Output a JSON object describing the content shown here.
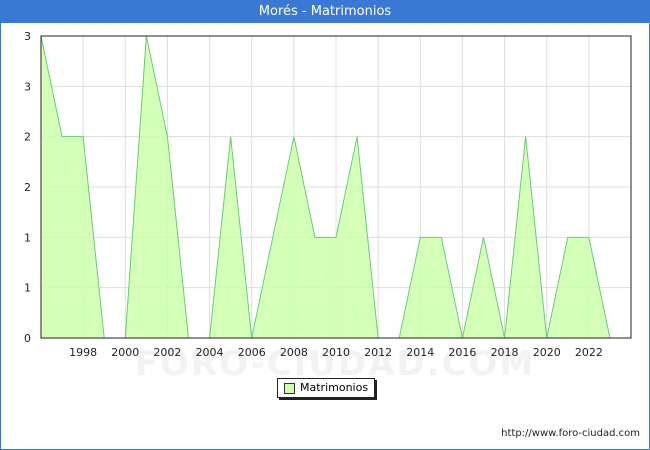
{
  "title": "Morés - Matrimonios",
  "source_url": "http://www.foro-ciudad.com",
  "watermark": "FORO-CIUDAD.COM",
  "colors": {
    "title_bg": "#3a78d6",
    "area_fill": "#ccffaa",
    "area_line": "#66cc77",
    "grid": "#dddddd"
  },
  "chart_data": {
    "type": "area",
    "title": "Morés - Matrimonios",
    "xlabel": "",
    "ylabel": "",
    "x": [
      1996,
      1997,
      1998,
      1999,
      2000,
      2001,
      2002,
      2003,
      2004,
      2005,
      2006,
      2007,
      2008,
      2009,
      2010,
      2011,
      2012,
      2013,
      2014,
      2015,
      2016,
      2017,
      2018,
      2019,
      2020,
      2021,
      2022,
      2023
    ],
    "series": [
      {
        "name": "Matrimonios",
        "values": [
          3,
          2,
          2,
          0,
          0,
          3,
          2,
          0,
          0,
          2,
          0,
          1,
          2,
          1,
          1,
          2,
          0,
          0,
          1,
          1,
          0,
          1,
          0,
          2,
          0,
          1,
          1,
          0
        ]
      }
    ],
    "xlim": [
      1996,
      2024
    ],
    "ylim": [
      0,
      3
    ],
    "x_tick_labels": [
      "1998",
      "2000",
      "2002",
      "2004",
      "2006",
      "2008",
      "2010",
      "2012",
      "2014",
      "2016",
      "2018",
      "2020",
      "2022"
    ],
    "y_tick_labels": [
      "0",
      "1",
      "1",
      "2",
      "2",
      "3",
      "3"
    ],
    "grid": true,
    "legend_position": "bottom-center"
  }
}
